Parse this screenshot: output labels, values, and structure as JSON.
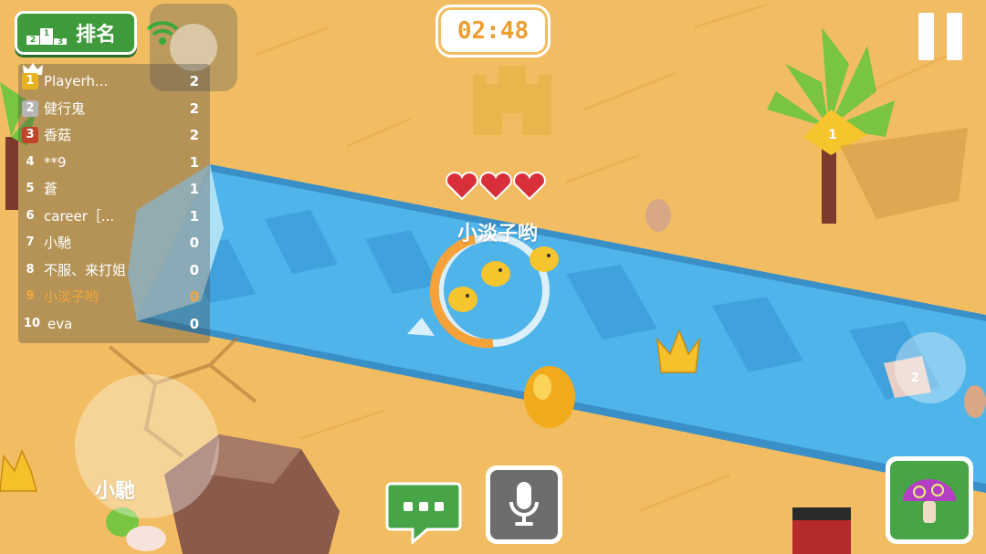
{
  "hud": {
    "rank_label": "排名",
    "podium_numbers": [
      "2",
      "1",
      "3"
    ],
    "timer": "02:48",
    "player_name": "小淡子哟",
    "other_player_name": "小馳",
    "hearts": 3,
    "tree_marker": "1",
    "item_marker": "2"
  },
  "leaderboard": [
    {
      "rank": "1",
      "name": "Playerh...",
      "score": "2"
    },
    {
      "rank": "2",
      "name": "健行鬼",
      "score": "2"
    },
    {
      "rank": "3",
      "name": "香菇",
      "score": "2"
    },
    {
      "rank": "4",
      "name": "**9",
      "score": "1"
    },
    {
      "rank": "5",
      "name": "蒼",
      "score": "1"
    },
    {
      "rank": "6",
      "name": "career［...",
      "score": "1"
    },
    {
      "rank": "7",
      "name": "小馳",
      "score": "0"
    },
    {
      "rank": "8",
      "name": "不服、来打姐",
      "score": "0"
    },
    {
      "rank": "9",
      "name": "小淡子哟",
      "score": "0"
    },
    {
      "rank": "10",
      "name": "eva",
      "score": "0"
    }
  ],
  "colors": {
    "sand": "#f2bd62",
    "river": "#4fb4ea",
    "rank_green": "#3f9a3c",
    "highlight_orange": "#f4a83a",
    "gold_badge": "#e7b21f",
    "silver_badge": "#b5b5b5",
    "bronze_badge": "#c0442a"
  },
  "icons": [
    "podium-icon",
    "wifi-icon",
    "pause-icon",
    "chat-icon",
    "microphone-icon",
    "mushroom-icon",
    "crown-icon",
    "heart-icon"
  ]
}
